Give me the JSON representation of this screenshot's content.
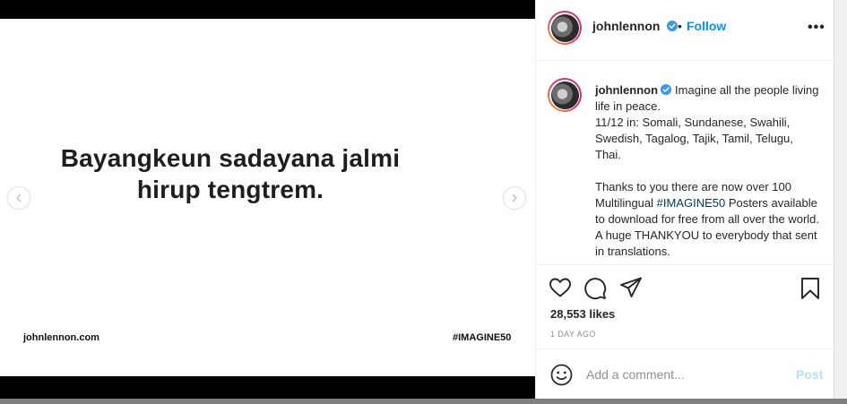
{
  "media": {
    "slide_line1": "Bayangkeun sadayana jalmi",
    "slide_line2": "hirup tengtrem.",
    "footer_left": "johnlennon.com",
    "footer_right": "#IMAGINE50"
  },
  "header": {
    "username": "johnlennon",
    "separator": "•",
    "follow_label": "Follow",
    "more_label": "•••"
  },
  "caption": {
    "username": "johnlennon",
    "text_part1": "Imagine all the people living life in peace.\n11/12 in: Somali, Sundanese, Swahili, Swedish, Tagalog, Tajik, Tamil, Telugu, Thai.\n\nThanks to you there are now over 100 Multilingual ",
    "hashtag": "#IMAGINE50",
    "text_part2": " Posters available to download for free from all over the world. A huge THANKYOU to everybody that sent in translations."
  },
  "stats": {
    "likes": "28,553 likes",
    "time": "1 DAY AGO"
  },
  "comment": {
    "placeholder": "Add a comment...",
    "post_label": "Post"
  },
  "colors": {
    "accent": "#0095f6",
    "post_disabled": "#b2dffc",
    "hashtag": "#00376b",
    "verified": "#3897f0"
  }
}
